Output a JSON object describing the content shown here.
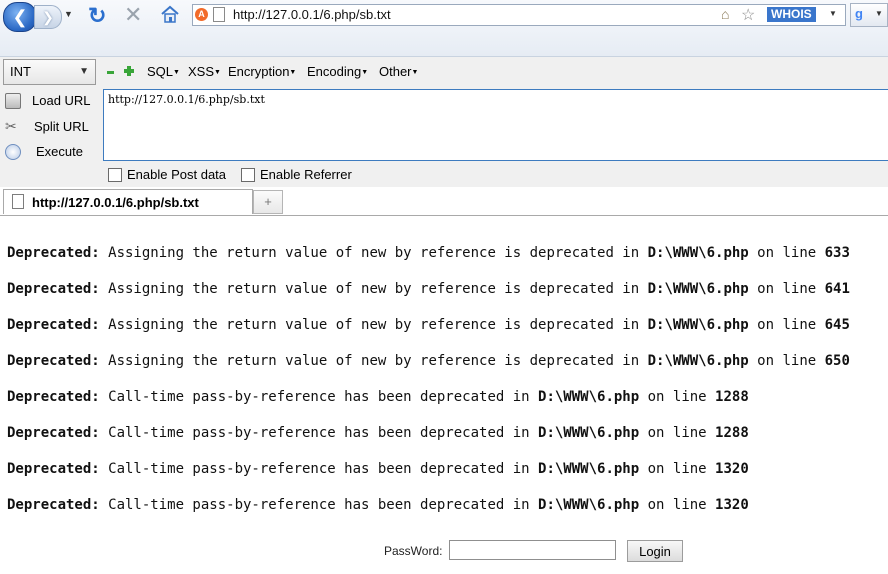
{
  "browser": {
    "address_url": "http://127.0.0.1/6.php/sb.txt",
    "whois_label": "WHOIS",
    "site_badge": "A"
  },
  "hackbar": {
    "type_select": "INT",
    "menus": [
      "SQL",
      "XSS",
      "Encryption",
      "Encoding",
      "Other"
    ],
    "actions": {
      "load_url": "Load URL",
      "split_url": "Split URL",
      "execute": "Execute"
    },
    "url_value": "http://127.0.0.1/6.php/sb.txt",
    "enable_post": "Enable Post data",
    "enable_referrer": "Enable Referrer"
  },
  "tab": {
    "title": "http://127.0.0.1/6.php/sb.txt"
  },
  "errors": [
    {
      "level": "Deprecated:",
      "message": " Assigning the return value of new by reference is deprecated in ",
      "file": "D:\\WWW\\6.php",
      "on_line": " on line ",
      "line": "633"
    },
    {
      "level": "Deprecated:",
      "message": " Assigning the return value of new by reference is deprecated in ",
      "file": "D:\\WWW\\6.php",
      "on_line": " on line ",
      "line": "641"
    },
    {
      "level": "Deprecated:",
      "message": " Assigning the return value of new by reference is deprecated in ",
      "file": "D:\\WWW\\6.php",
      "on_line": " on line ",
      "line": "645"
    },
    {
      "level": "Deprecated:",
      "message": " Assigning the return value of new by reference is deprecated in ",
      "file": "D:\\WWW\\6.php",
      "on_line": " on line ",
      "line": "650"
    },
    {
      "level": "Deprecated:",
      "message": " Call-time pass-by-reference has been deprecated in ",
      "file": "D:\\WWW\\6.php",
      "on_line": " on line ",
      "line": "1288"
    },
    {
      "level": "Deprecated:",
      "message": " Call-time pass-by-reference has been deprecated in ",
      "file": "D:\\WWW\\6.php",
      "on_line": " on line ",
      "line": "1288"
    },
    {
      "level": "Deprecated:",
      "message": " Call-time pass-by-reference has been deprecated in ",
      "file": "D:\\WWW\\6.php",
      "on_line": " on line ",
      "line": "1320"
    },
    {
      "level": "Deprecated:",
      "message": " Call-time pass-by-reference has been deprecated in ",
      "file": "D:\\WWW\\6.php",
      "on_line": " on line ",
      "line": "1320"
    }
  ],
  "login": {
    "password_label": "PassWord:",
    "password_value": "",
    "button_label": "Login"
  }
}
